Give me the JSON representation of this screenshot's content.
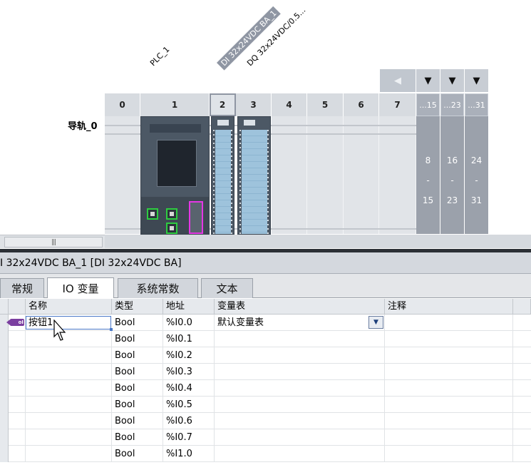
{
  "device_view": {
    "labels": {
      "plc": "PLC_1",
      "di_module": "DI 32x24VDC BA_1",
      "dq_module": "DQ 32x24VDC/0.5..."
    },
    "rail_label": "导轨_0",
    "slots": [
      "0",
      "1",
      "2",
      "3",
      "4",
      "5",
      "6",
      "7"
    ],
    "expansion_heads": [
      "...15",
      "...23",
      "...31"
    ],
    "expansion_cols": [
      {
        "top": "8",
        "mid": "-",
        "bottom": "15"
      },
      {
        "top": "16",
        "mid": "-",
        "bottom": "23"
      },
      {
        "top": "24",
        "mid": "-",
        "bottom": "31"
      }
    ],
    "arrows": {
      "left": "◀",
      "down": "▼"
    },
    "scroll_grip": "|||"
  },
  "panel": {
    "title": "I 32x24VDC BA_1 [DI 32x24VDC BA]",
    "tabs": [
      "常规",
      "IO 变量",
      "系统常数",
      "文本"
    ],
    "active_tab": "IO 变量"
  },
  "tag_table": {
    "columns": [
      "名称",
      "类型",
      "地址",
      "变量表",
      "注释"
    ],
    "rows": [
      {
        "name": "按钮1",
        "type": "Bool",
        "address": "%I0.0",
        "table": "默认变量表",
        "comment": ""
      },
      {
        "name": "",
        "type": "Bool",
        "address": "%I0.1",
        "table": "",
        "comment": ""
      },
      {
        "name": "",
        "type": "Bool",
        "address": "%I0.2",
        "table": "",
        "comment": ""
      },
      {
        "name": "",
        "type": "Bool",
        "address": "%I0.3",
        "table": "",
        "comment": ""
      },
      {
        "name": "",
        "type": "Bool",
        "address": "%I0.4",
        "table": "",
        "comment": ""
      },
      {
        "name": "",
        "type": "Bool",
        "address": "%I0.5",
        "table": "",
        "comment": ""
      },
      {
        "name": "",
        "type": "Bool",
        "address": "%I0.6",
        "table": "",
        "comment": ""
      },
      {
        "name": "",
        "type": "Bool",
        "address": "%I0.7",
        "table": "",
        "comment": ""
      },
      {
        "name": "",
        "type": "Bool",
        "address": "%I1.0",
        "table": "",
        "comment": ""
      }
    ],
    "tag_icon_text": "oI",
    "dropdown_icon": "▼"
  },
  "colors": {
    "accent_selection": "#4a78c8",
    "port_green": "#2ecc40",
    "port_magenta": "#e536e5",
    "tag_icon": "#7b3fa0"
  }
}
